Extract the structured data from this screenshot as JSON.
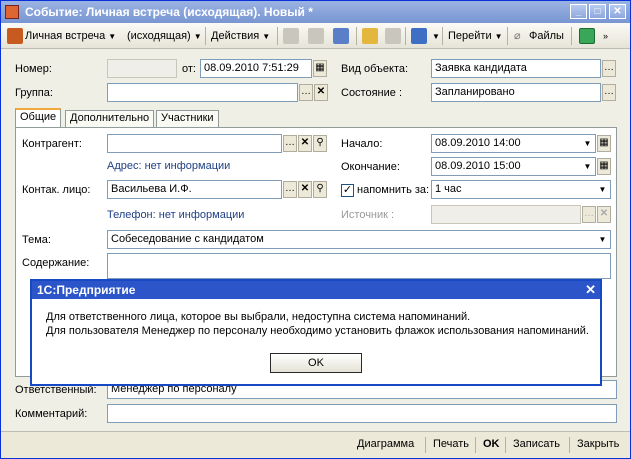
{
  "window": {
    "title": "Событие: Личная встреча (исходящая). Новый *"
  },
  "toolbar": {
    "type_menu": "Личная встреча",
    "direction_menu": "(исходящая)",
    "actions_menu": "Действия",
    "goto_menu": "Перейти",
    "files": "Файлы"
  },
  "header": {
    "number_label": "Номер:",
    "number_value": "",
    "from_label": "от:",
    "date_value": "08.09.2010  7:51:29",
    "object_type_label": "Вид объекта:",
    "object_type_value": "Заявка кандидата",
    "group_label": "Группа:",
    "group_value": "",
    "state_label": "Состояние :",
    "state_value": "Запланировано"
  },
  "tabs": [
    "Общие",
    "Дополнительно",
    "Участники"
  ],
  "general": {
    "counterparty_label": "Контрагент:",
    "counterparty_value": "",
    "address_info": "Адрес: нет информации",
    "contact_label": "Контак. лицо:",
    "contact_value": "Васильева И.Ф.",
    "phone_info": "Телефон: нет информации",
    "start_label": "Начало:",
    "start_value": "08.09.2010 14:00",
    "end_label": "Окончание:",
    "end_value": "08.09.2010 15:00",
    "remind_label": "напомнить за:",
    "remind_value": "1 час",
    "remind_checked": true,
    "source_label": "Источник :",
    "source_value": "",
    "subject_label": "Тема:",
    "subject_value": "Собеседование с кандидатом",
    "content_label": "Содержание:"
  },
  "footer_fields": {
    "responsible_label": "Ответственный:",
    "responsible_value": "Менеджер по персоналу",
    "comment_label": "Комментарий:",
    "comment_value": ""
  },
  "dialog": {
    "title": "1С:Предприятие",
    "line1": "Для ответственного лица, которое вы выбрали, недоступна система напоминаний.",
    "line2": "Для пользователя Менеджер по персоналу необходимо установить флажок использования напоминаний.",
    "ok": "OK"
  },
  "bottom": {
    "diagram": "Диаграмма",
    "print": "Печать",
    "ok": "OK",
    "save": "Записать",
    "close": "Закрыть"
  },
  "colors": {
    "title_bar": "#7896d2",
    "dialog_title": "#2b55c9",
    "link_text": "#203f84"
  }
}
